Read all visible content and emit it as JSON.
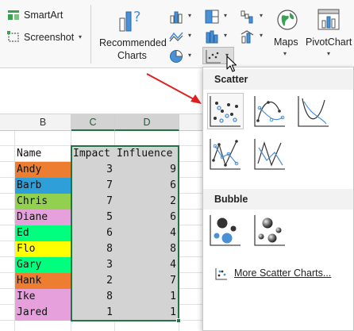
{
  "ribbon": {
    "smartart_label": "SmartArt",
    "screenshot_label": "Screenshot",
    "recommended_charts_line1": "Recommended",
    "recommended_charts_line2": "Charts",
    "maps_label": "Maps",
    "pivotchart_label": "PivotChart"
  },
  "grid": {
    "column_headers": [
      "B",
      "C",
      "D"
    ],
    "header_row": [
      "Name",
      "Impact",
      "Influence"
    ],
    "rows": [
      {
        "name": "Andy",
        "impact": "3",
        "influence": "9",
        "color": "#ed7d31"
      },
      {
        "name": "Barb",
        "impact": "7",
        "influence": "6",
        "color": "#2e9fd8"
      },
      {
        "name": "Chris",
        "impact": "7",
        "influence": "2",
        "color": "#92d050"
      },
      {
        "name": "Diane",
        "impact": "5",
        "influence": "6",
        "color": "#e6a0dc"
      },
      {
        "name": "Ed",
        "impact": "6",
        "influence": "4",
        "color": "#00ff7f"
      },
      {
        "name": "Flo",
        "impact": "8",
        "influence": "8",
        "color": "#ffff00"
      },
      {
        "name": "Gary",
        "impact": "3",
        "influence": "4",
        "color": "#00ff7f"
      },
      {
        "name": "Hank",
        "impact": "2",
        "influence": "7",
        "color": "#ed7d31"
      },
      {
        "name": "Ike",
        "impact": "8",
        "influence": "1",
        "color": "#e6a0dc"
      },
      {
        "name": "Jared",
        "impact": "1",
        "influence": "1",
        "color": "#e6a0dc"
      }
    ]
  },
  "dropdown": {
    "scatter_header": "Scatter",
    "bubble_header": "Bubble",
    "more_link": "More Scatter Charts..."
  },
  "colors": {
    "excel_green": "#217346",
    "chart_blue": "#4a90d6",
    "arrow_red": "#e02020"
  }
}
